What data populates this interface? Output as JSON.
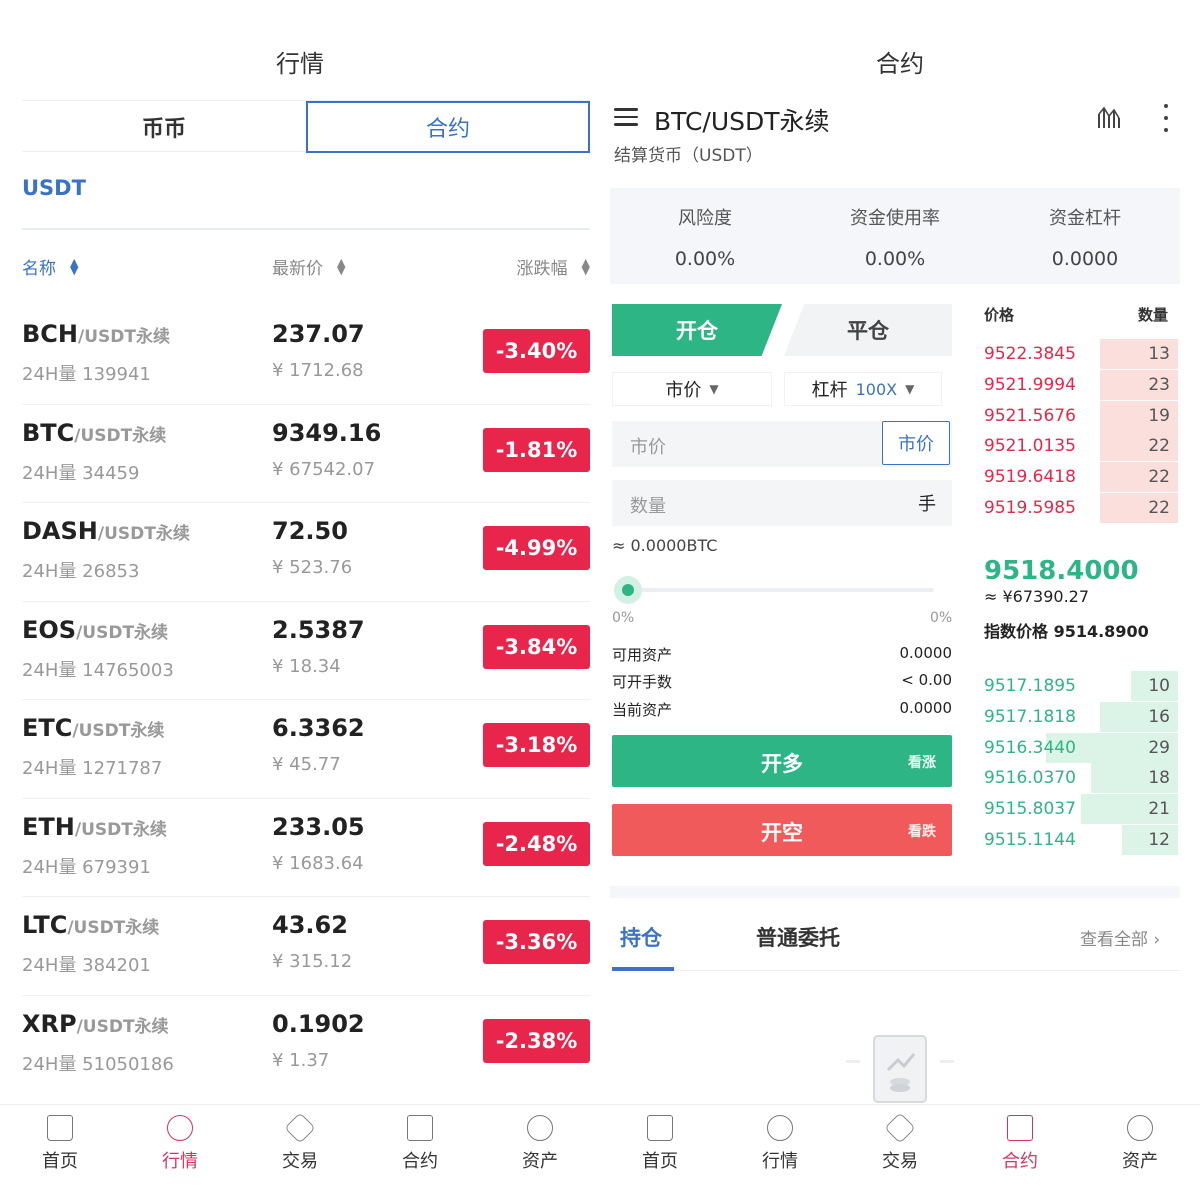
{
  "left": {
    "title": "行情",
    "segments": [
      "币币",
      "合约"
    ],
    "quote_tab": "USDT",
    "headers": {
      "name": "名称",
      "price": "最新价",
      "change": "涨跌幅"
    },
    "rows": [
      {
        "symbol": "BCH",
        "suffix": "/USDT永续",
        "volume": "24H量 139941",
        "price": "237.07",
        "cny": "¥ 1712.68",
        "change": "-3.40%"
      },
      {
        "symbol": "BTC",
        "suffix": "/USDT永续",
        "volume": "24H量 34459",
        "price": "9349.16",
        "cny": "¥ 67542.07",
        "change": "-1.81%"
      },
      {
        "symbol": "DASH",
        "suffix": "/USDT永续",
        "volume": "24H量 26853",
        "price": "72.50",
        "cny": "¥ 523.76",
        "change": "-4.99%"
      },
      {
        "symbol": "EOS",
        "suffix": "/USDT永续",
        "volume": "24H量 14765003",
        "price": "2.5387",
        "cny": "¥ 18.34",
        "change": "-3.84%"
      },
      {
        "symbol": "ETC",
        "suffix": "/USDT永续",
        "volume": "24H量 1271787",
        "price": "6.3362",
        "cny": "¥ 45.77",
        "change": "-3.18%"
      },
      {
        "symbol": "ETH",
        "suffix": "/USDT永续",
        "volume": "24H量 679391",
        "price": "233.05",
        "cny": "¥ 1683.64",
        "change": "-2.48%"
      },
      {
        "symbol": "LTC",
        "suffix": "/USDT永续",
        "volume": "24H量 384201",
        "price": "43.62",
        "cny": "¥ 315.12",
        "change": "-3.36%"
      },
      {
        "symbol": "XRP",
        "suffix": "/USDT永续",
        "volume": "24H量 51050186",
        "price": "0.1902",
        "cny": "¥ 1.37",
        "change": "-2.38%"
      }
    ],
    "tabbar": [
      {
        "label": "首页",
        "icon": "home-icon"
      },
      {
        "label": "行情",
        "icon": "market-icon",
        "active": true
      },
      {
        "label": "交易",
        "icon": "trade-icon"
      },
      {
        "label": "合约",
        "icon": "contract-icon"
      },
      {
        "label": "资产",
        "icon": "assets-icon"
      }
    ]
  },
  "right": {
    "title": "合约",
    "pair": "BTC/USDT永续",
    "settle": "结算货币（USDT）",
    "stats": [
      {
        "label": "风险度",
        "value": "0.00%"
      },
      {
        "label": "资金使用率",
        "value": "0.00%"
      },
      {
        "label": "资金杠杆",
        "value": "0.0000"
      }
    ],
    "open_label": "开仓",
    "close_label": "平仓",
    "order_type": "市价",
    "leverage_label": "杠杆",
    "leverage_value": "100X",
    "price_placeholder": "市价",
    "price_button": "市价",
    "qty_placeholder": "数量",
    "qty_unit": "手",
    "eq_btc": "≈ 0.0000BTC",
    "slider_min": "0%",
    "slider_max": "0%",
    "slider_value": 0,
    "balances": [
      {
        "label": "可用资产",
        "value": "0.0000"
      },
      {
        "label": "可开手数",
        "value": "< 0.00"
      },
      {
        "label": "当前资产",
        "value": "0.0000"
      }
    ],
    "long_btn": {
      "label": "开多",
      "sub": "看涨"
    },
    "short_btn": {
      "label": "开空",
      "sub": "看跌"
    },
    "orderbook": {
      "price_header": "价格",
      "qty_header": "数量",
      "asks": [
        {
          "price": "9522.3845",
          "qty": "13",
          "depth": 0.4
        },
        {
          "price": "9521.9994",
          "qty": "23",
          "depth": 0.4
        },
        {
          "price": "9521.5676",
          "qty": "19",
          "depth": 0.4
        },
        {
          "price": "9521.0135",
          "qty": "22",
          "depth": 0.4
        },
        {
          "price": "9519.6418",
          "qty": "22",
          "depth": 0.4
        },
        {
          "price": "9519.5985",
          "qty": "22",
          "depth": 0.4
        }
      ],
      "last_price": "9518.4000",
      "last_cny": "≈ ¥67390.27",
      "index_price": "指数价格 9514.8900",
      "bids": [
        {
          "price": "9517.1895",
          "qty": "10",
          "depth": 0.24
        },
        {
          "price": "9517.1818",
          "qty": "16",
          "depth": 0.4
        },
        {
          "price": "9516.3440",
          "qty": "29",
          "depth": 0.68
        },
        {
          "price": "9516.0370",
          "qty": "18",
          "depth": 0.45
        },
        {
          "price": "9515.8037",
          "qty": "21",
          "depth": 0.5
        },
        {
          "price": "9515.1144",
          "qty": "12",
          "depth": 0.29
        }
      ]
    },
    "position_tabs": [
      "持仓",
      "普通委托"
    ],
    "view_all": "查看全部 ›",
    "tabbar": [
      {
        "label": "首页",
        "icon": "home-icon"
      },
      {
        "label": "行情",
        "icon": "market-icon"
      },
      {
        "label": "交易",
        "icon": "trade-icon"
      },
      {
        "label": "合约",
        "icon": "contract-icon",
        "active": true
      },
      {
        "label": "资产",
        "icon": "assets-icon"
      }
    ]
  },
  "colors": {
    "accent_blue": "#3a72c4",
    "up_green": "#2db585",
    "down_red": "#e8254a",
    "tab_active": "#d8345f"
  }
}
